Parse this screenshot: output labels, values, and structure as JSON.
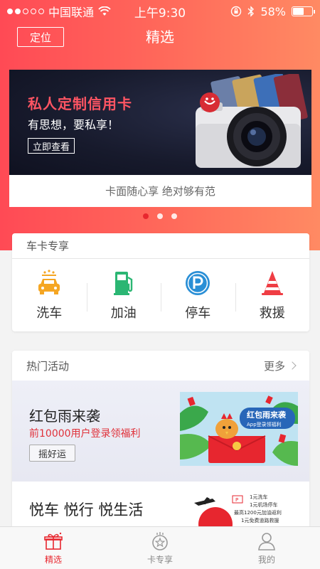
{
  "status_bar": {
    "carrier": "中国联通",
    "time": "上午9:30",
    "battery_text": "58%",
    "battery_level": 0.58,
    "signal_bars_filled": 2,
    "signal_bars_total": 5
  },
  "nav": {
    "locate_label": "定位",
    "title": "精选"
  },
  "banner": {
    "title": "私人定制信用卡",
    "subtitle": "有思想，要私享！",
    "cta_label": "立即查看",
    "caption": "卡面随心享 绝对够有范",
    "page_count": 3,
    "active_page": 1
  },
  "car_section": {
    "header": "车卡专享",
    "services": [
      {
        "label": "洗车",
        "icon": "car-wash-icon",
        "color": "#f5a623"
      },
      {
        "label": "加油",
        "icon": "fuel-pump-icon",
        "color": "#2bb673"
      },
      {
        "label": "停车",
        "icon": "parking-icon",
        "color": "#2a8fd6"
      },
      {
        "label": "救援",
        "icon": "traffic-cone-icon",
        "color": "#ef3d44"
      }
    ]
  },
  "hot_section": {
    "header": "热门活动",
    "more_label": "更多",
    "promos": [
      {
        "title": "红包雨来袭",
        "subtitle": "前10000用户登录领福利",
        "button_label": "摇好运",
        "image_text_main": "红包雨来袭",
        "image_text_sub": "App登录领福利"
      },
      {
        "title": "悦车 悦行 悦生活",
        "image_lines": [
          "1元洗车",
          "1元机场停车",
          "最高1200元加油返利",
          "1元免费道路救援"
        ]
      }
    ]
  },
  "tab_bar": {
    "tabs": [
      {
        "label": "精选",
        "icon": "gift-icon",
        "active": true
      },
      {
        "label": "卡专享",
        "icon": "card-badge-icon",
        "active": false
      },
      {
        "label": "我的",
        "icon": "user-icon",
        "active": false
      }
    ]
  },
  "colors": {
    "brand_red": "#e8272f",
    "header_gradient_start": "#ff4a55",
    "header_gradient_end": "#ff8a63"
  }
}
